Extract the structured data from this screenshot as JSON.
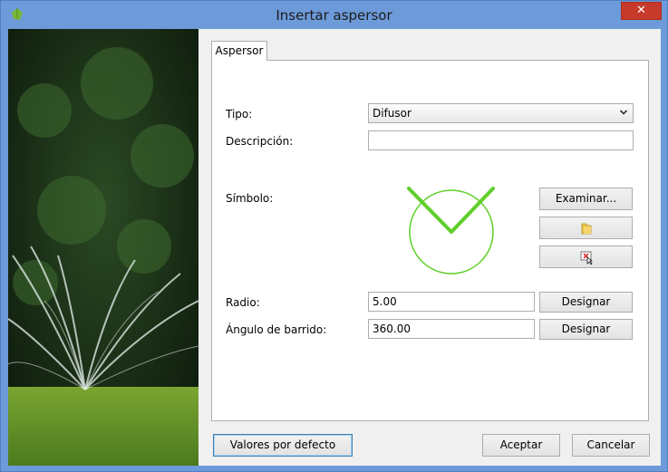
{
  "window": {
    "title": "Insertar aspersor",
    "close_label": "✕"
  },
  "tabs": [
    {
      "label": "Aspersor"
    }
  ],
  "form": {
    "tipo": {
      "label": "Tipo:",
      "value": "Difusor"
    },
    "descripcion": {
      "label": "Descripción:",
      "value": ""
    },
    "simbolo": {
      "label": "Símbolo:"
    },
    "radio": {
      "label": "Radio:",
      "value": "5.00"
    },
    "angulo": {
      "label": "Ángulo de barrido:",
      "value": "360.00"
    }
  },
  "buttons": {
    "examinar": "Examinar...",
    "designar_radio": "Designar",
    "designar_angulo": "Designar",
    "valores_por_defecto": "Valores por defecto",
    "aceptar": "Aceptar",
    "cancelar": "Cancelar"
  },
  "icons": {
    "app": "app-leaf-icon",
    "folder": "folder-icon",
    "delete": "delete-symbol-icon",
    "dropdown": "chevron-down-icon"
  },
  "colors": {
    "symbol": "#5fcf2a",
    "titlebar": "#6d9ad9",
    "close": "#c7392a"
  }
}
